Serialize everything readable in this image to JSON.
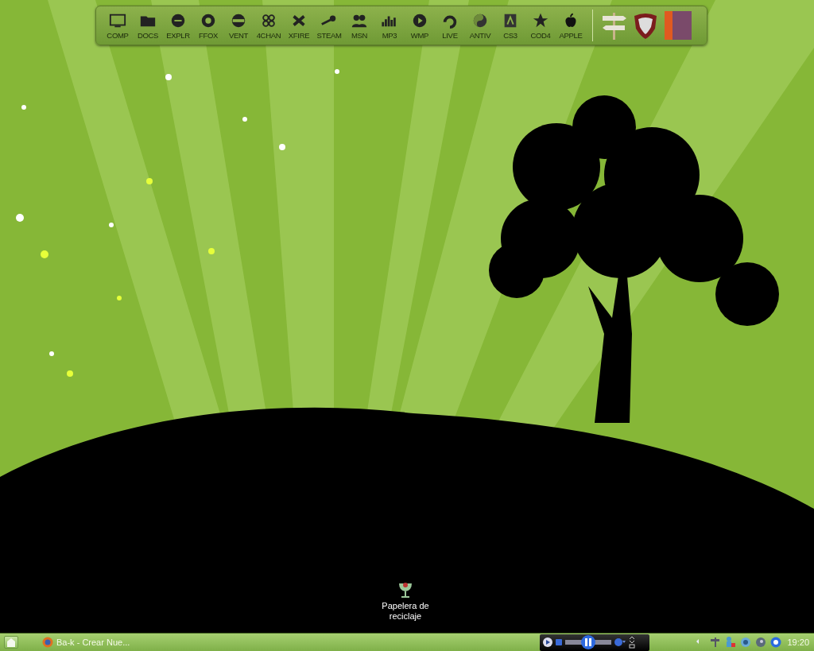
{
  "dock": {
    "items": [
      {
        "label": "COMP"
      },
      {
        "label": "DOCS"
      },
      {
        "label": "EXPLR"
      },
      {
        "label": "FFOX"
      },
      {
        "label": "VENT"
      },
      {
        "label": "4CHAN"
      },
      {
        "label": "XFIRE"
      },
      {
        "label": "STEAM"
      },
      {
        "label": "MSN"
      },
      {
        "label": "MP3"
      },
      {
        "label": "WMP"
      },
      {
        "label": "LIVE"
      },
      {
        "label": "ANTIV"
      },
      {
        "label": "CS3"
      },
      {
        "label": "COD4"
      },
      {
        "label": "APPLE"
      }
    ]
  },
  "desktop_icons": [
    {
      "label": "Papelera de reciclaje"
    }
  ],
  "taskbar": {
    "tasks": [
      {
        "label": "Ba-k - Crear Nue..."
      }
    ],
    "clock": "19:20"
  }
}
